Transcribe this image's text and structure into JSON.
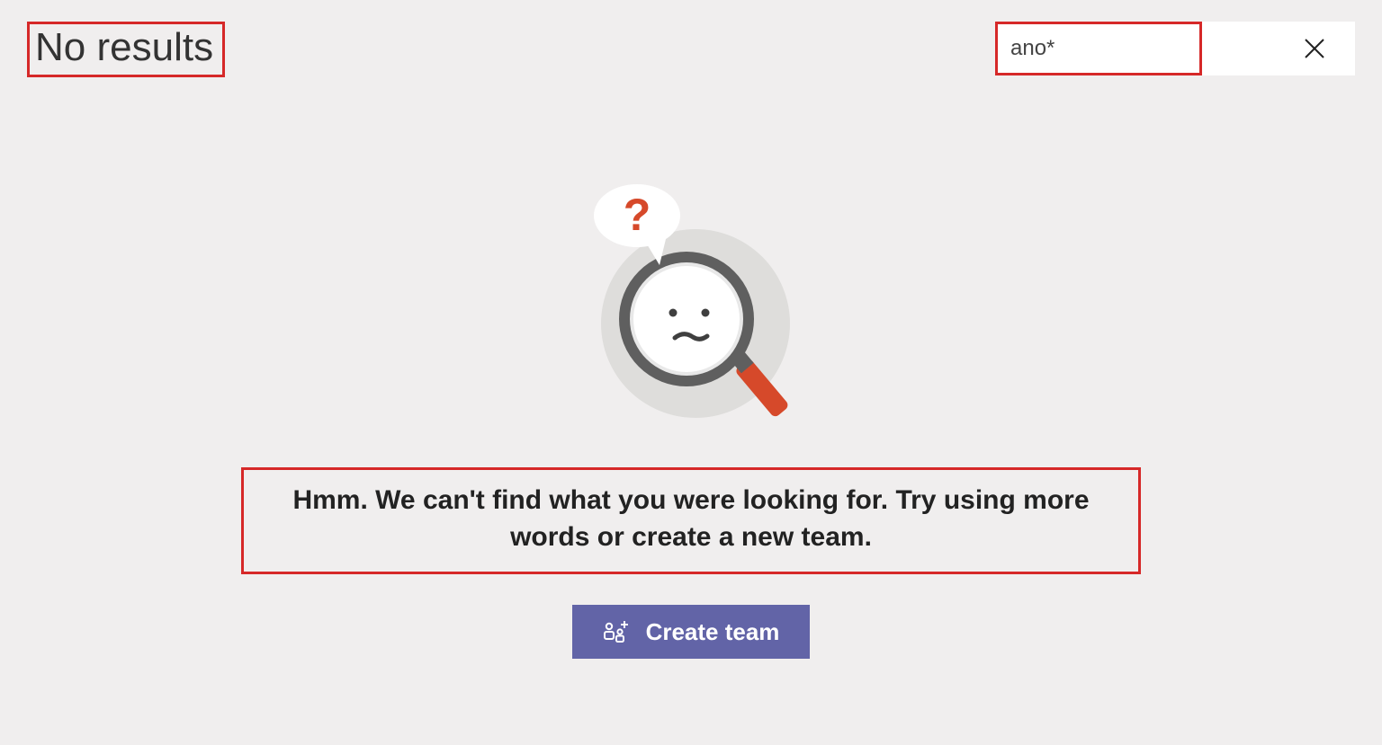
{
  "header": {
    "title": "No results"
  },
  "search": {
    "value": "ano*"
  },
  "empty_state": {
    "message": "Hmm. We can't find what you were looking for. Try using more words or create a new team.",
    "create_label": "Create team"
  }
}
